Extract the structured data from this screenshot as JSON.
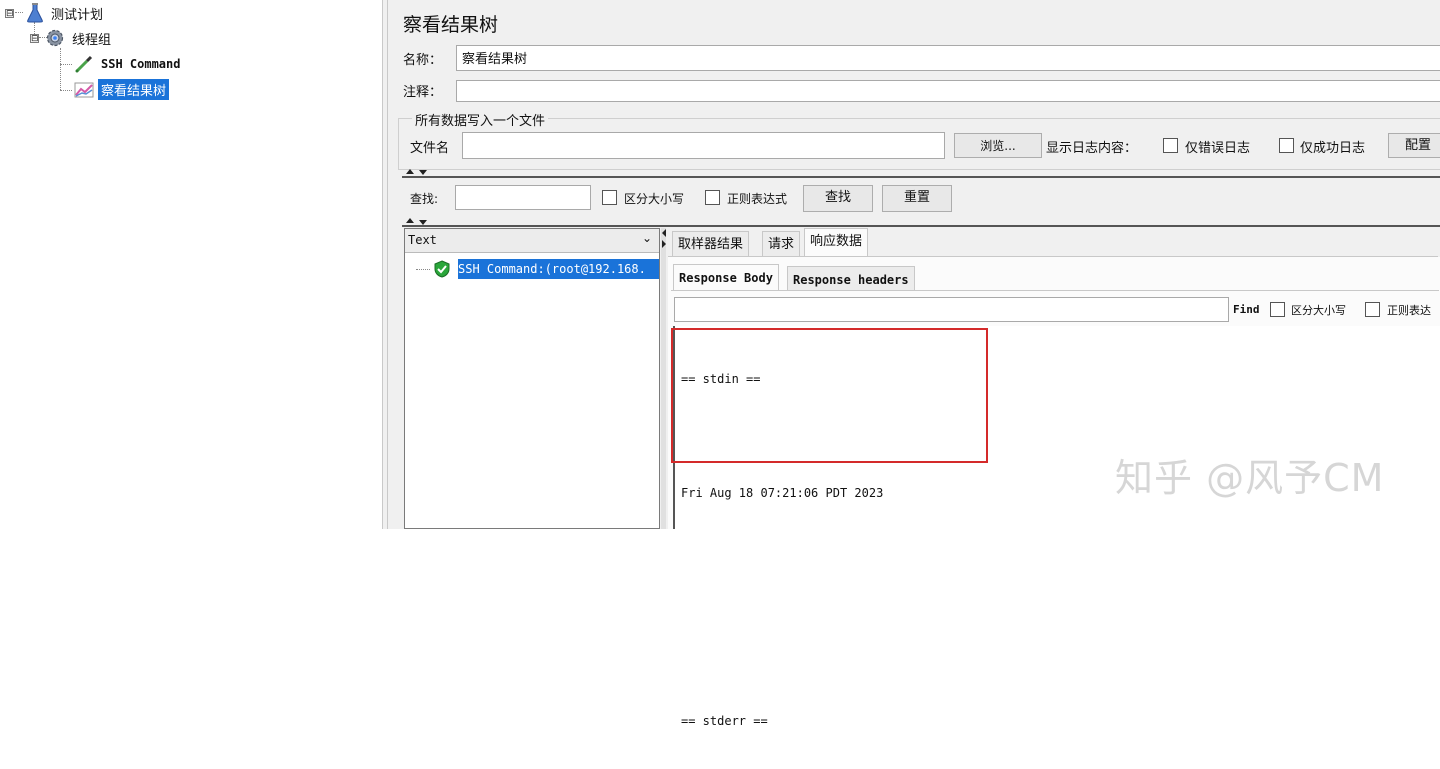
{
  "tree": {
    "items": [
      {
        "label": "测试计划",
        "expander": "⊟",
        "icon": "test-plan-flask-icon"
      },
      {
        "label": "线程组",
        "expander": "⊟",
        "icon": "thread-group-gear-icon"
      },
      {
        "label": "SSH Command",
        "icon": "sampler-pipette-icon"
      },
      {
        "label": "察看结果树",
        "icon": "listener-graph-icon"
      }
    ]
  },
  "panel": {
    "title": "察看结果树",
    "name_label": "名称：",
    "name_value": "察看结果树",
    "comment_label": "注释：",
    "comment_value": "",
    "file_group_title": "所有数据写入一个文件",
    "filename_label": "文件名",
    "filename_value": "",
    "browse_button": "浏览...",
    "log_content_label": "显示日志内容：",
    "errors_only": "仅错误日志",
    "success_only": "仅成功日志",
    "config_button": "配置"
  },
  "search": {
    "label": "查找:",
    "value": "",
    "case_sensitive": "区分大小写",
    "regex": "正则表达式",
    "find_button": "查找",
    "reset_button": "重置"
  },
  "results": {
    "renderer": "Text",
    "sample_label": "SSH Command:(root@192.168.",
    "sample_status": "success",
    "tabs": [
      "取样器结果",
      "请求",
      "响应数据"
    ],
    "active_tab": "响应数据",
    "subtabs": [
      "Response Body",
      "Response headers"
    ],
    "active_subtab": "Response Body",
    "find_label": "Find",
    "find_case": "区分大小写",
    "find_regex": "正则表达",
    "body_lines": [
      "== stdin ==",
      "",
      "Fri Aug 18 07:21:06 PDT 2023",
      "",
      "",
      "",
      "== stderr =="
    ]
  },
  "watermark": "知乎 @风予CM",
  "colors": {
    "selection": "#1a73d9",
    "highlight_box": "#d42a2a",
    "success": "#2aa63a"
  }
}
